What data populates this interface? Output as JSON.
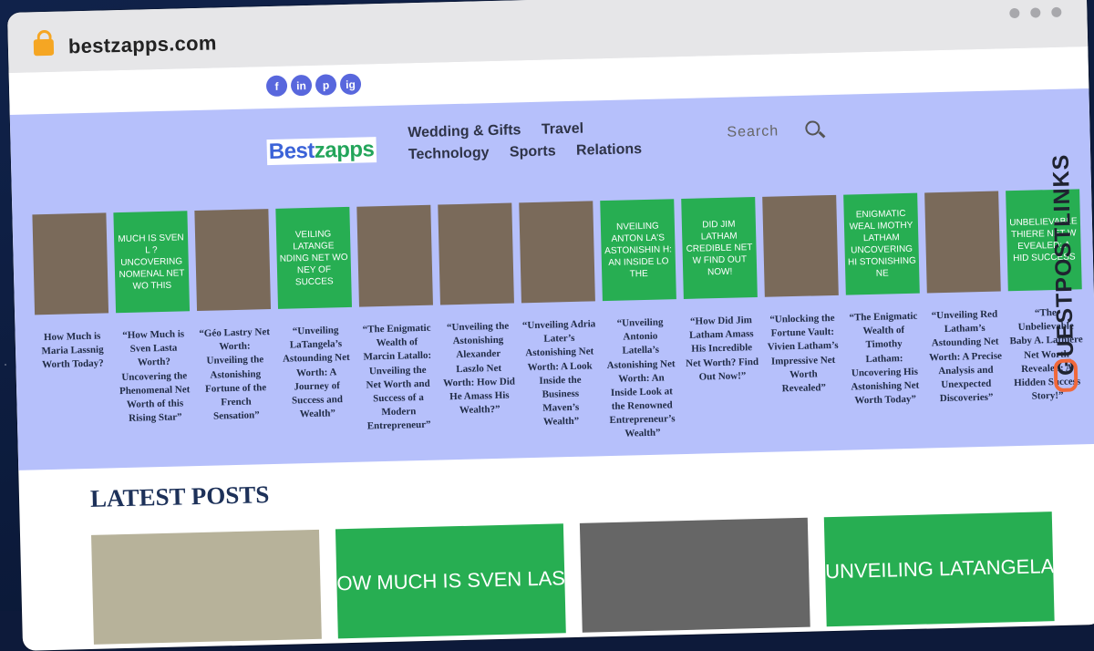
{
  "browser": {
    "url": "bestzapps.com"
  },
  "social": [
    "f",
    "in",
    "p",
    "ig"
  ],
  "site": {
    "logo_a": "Best",
    "logo_b": "zapps"
  },
  "nav": [
    "Wedding & Gifts",
    "Travel",
    "Technology",
    "Sports",
    "Relations"
  ],
  "search": {
    "placeholder": "Search"
  },
  "cards": [
    {
      "thumb_type": "photo",
      "thumb_text": "",
      "caption": "How Much is Maria Lassnig Worth Today?"
    },
    {
      "thumb_type": "green",
      "thumb_text": "MUCH IS SVEN L ? UNCOVERING NOMENAL NET WO THIS",
      "caption": "“How Much is Sven Lasta Worth? Uncovering the Phenomenal Net Worth of this Rising Star”"
    },
    {
      "thumb_type": "photo",
      "thumb_text": "",
      "caption": "“Géo Lastry Net Worth: Unveiling the Astonishing Fortune of the French Sensation”"
    },
    {
      "thumb_type": "green",
      "thumb_text": "VEILING LATANGE NDING NET WO NEY OF SUCCES",
      "caption": "“Unveiling LaTangela’s Astounding Net Worth: A Journey of Success and Wealth”"
    },
    {
      "thumb_type": "photo",
      "thumb_text": "",
      "caption": "“The Enigmatic Wealth of Marcin Latallo: Unveiling the Net Worth and Success of a Modern Entrepreneur”"
    },
    {
      "thumb_type": "photo",
      "thumb_text": "",
      "caption": "“Unveiling the Astonishing Alexander Laszlo Net Worth: How Did He Amass His Wealth?”"
    },
    {
      "thumb_type": "photo",
      "thumb_text": "",
      "caption": "“Unveiling Adria Later’s Astonishing Net Worth: A Look Inside the Business Maven’s Wealth”"
    },
    {
      "thumb_type": "green",
      "thumb_text": "NVEILING ANTON LA'S ASTONISHIN H: AN INSIDE LO THE",
      "caption": "“Unveiling Antonio Latella’s Astonishing Net Worth: An Inside Look at the Renowned Entrepreneur’s Wealth”"
    },
    {
      "thumb_type": "green",
      "thumb_text": "DID JIM LATHAM CREDIBLE NET W FIND OUT NOW!",
      "caption": "“How Did Jim Latham Amass His Incredible Net Worth? Find Out Now!”"
    },
    {
      "thumb_type": "photo",
      "thumb_text": "",
      "caption": "“Unlocking the Fortune Vault: Vivien Latham’s Impressive Net Worth Revealed”"
    },
    {
      "thumb_type": "green",
      "thumb_text": "ENIGMATIC WEAL IMOTHY LATHAM UNCOVERING HI STONISHING NE",
      "caption": "“The Enigmatic Wealth of Timothy Latham: Uncovering His Astonishing Net Worth Today”"
    },
    {
      "thumb_type": "photo",
      "thumb_text": "",
      "caption": "“Unveiling Red Latham’s Astounding Net Worth: A Precise Analysis and Unexpected Discoveries”"
    },
    {
      "thumb_type": "green",
      "thumb_text": "UNBELIEVABLE THIERE NET W EVEALED: A HID SUCCESS",
      "caption": "“The Unbelievable Baby A. Lathiere Net Worth Revealed: A Hidden Success Story!”"
    }
  ],
  "sidebar_brand": "GUESTPOSTLINKS",
  "latest": {
    "heading": "LATEST POSTS"
  },
  "posts": [
    {
      "type": "photo",
      "text": ""
    },
    {
      "type": "green",
      "text": "OW MUCH IS SVEN LAS"
    },
    {
      "type": "gray",
      "text": ""
    },
    {
      "type": "green",
      "text": "UNVEILING LATANGELA"
    }
  ],
  "colors": {
    "hero_bg": "#b6c0fb",
    "green": "#27ae52",
    "social": "#5867dd",
    "accent": "#f0683a"
  }
}
